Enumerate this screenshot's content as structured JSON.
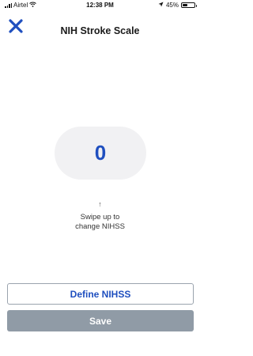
{
  "status_bar": {
    "carrier": "Airtel",
    "time": "12:38 PM",
    "battery_percent": "45%",
    "battery_level": 0.45,
    "icons": [
      "signal-icon",
      "wifi-icon",
      "location-arrow-icon",
      "battery-icon"
    ]
  },
  "header": {
    "title": "NIH Stroke Scale",
    "close_icon": "close-icon"
  },
  "score": {
    "value": "0"
  },
  "hint": {
    "arrow": "↑",
    "line1": "Swipe up to",
    "line2": "change NIHSS"
  },
  "buttons": {
    "define_label": "Define NIHSS",
    "save_label": "Save"
  },
  "colors": {
    "accent": "#1f4fbf",
    "save_disabled": "#909ba6",
    "pill_bg": "#f1f1f3"
  }
}
